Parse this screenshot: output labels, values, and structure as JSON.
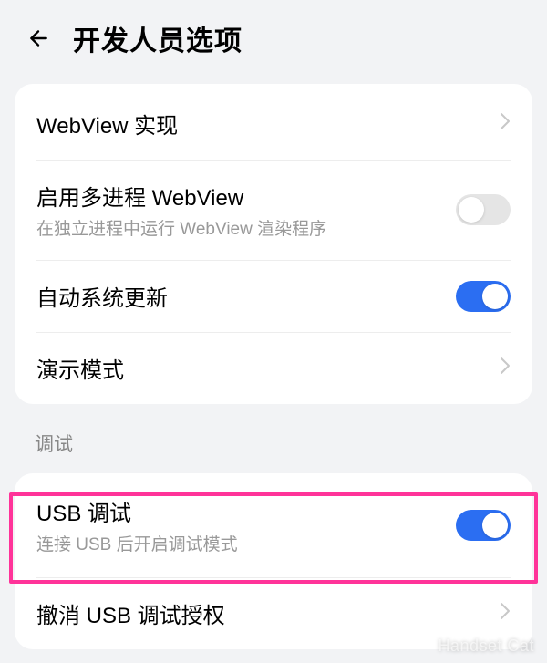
{
  "header": {
    "title": "开发人员选项"
  },
  "section1": {
    "webview_impl": {
      "title": "WebView 实现"
    },
    "multiprocess_webview": {
      "title": "启用多进程 WebView",
      "subtitle": "在独立进程中运行 WebView 渲染程序",
      "enabled": false
    },
    "auto_update": {
      "title": "自动系统更新",
      "enabled": true
    },
    "demo_mode": {
      "title": "演示模式"
    }
  },
  "section2": {
    "header": "调试",
    "usb_debug": {
      "title": "USB 调试",
      "subtitle": "连接 USB 后开启调试模式",
      "enabled": true
    },
    "revoke_usb": {
      "title": "撤消 USB 调试授权"
    }
  },
  "watermark": "Handset Cat",
  "colors": {
    "accent": "#2b6ef2",
    "highlight": "#ff3399",
    "background": "#f2f3f5",
    "card": "#ffffff",
    "subtitle": "#999999"
  }
}
